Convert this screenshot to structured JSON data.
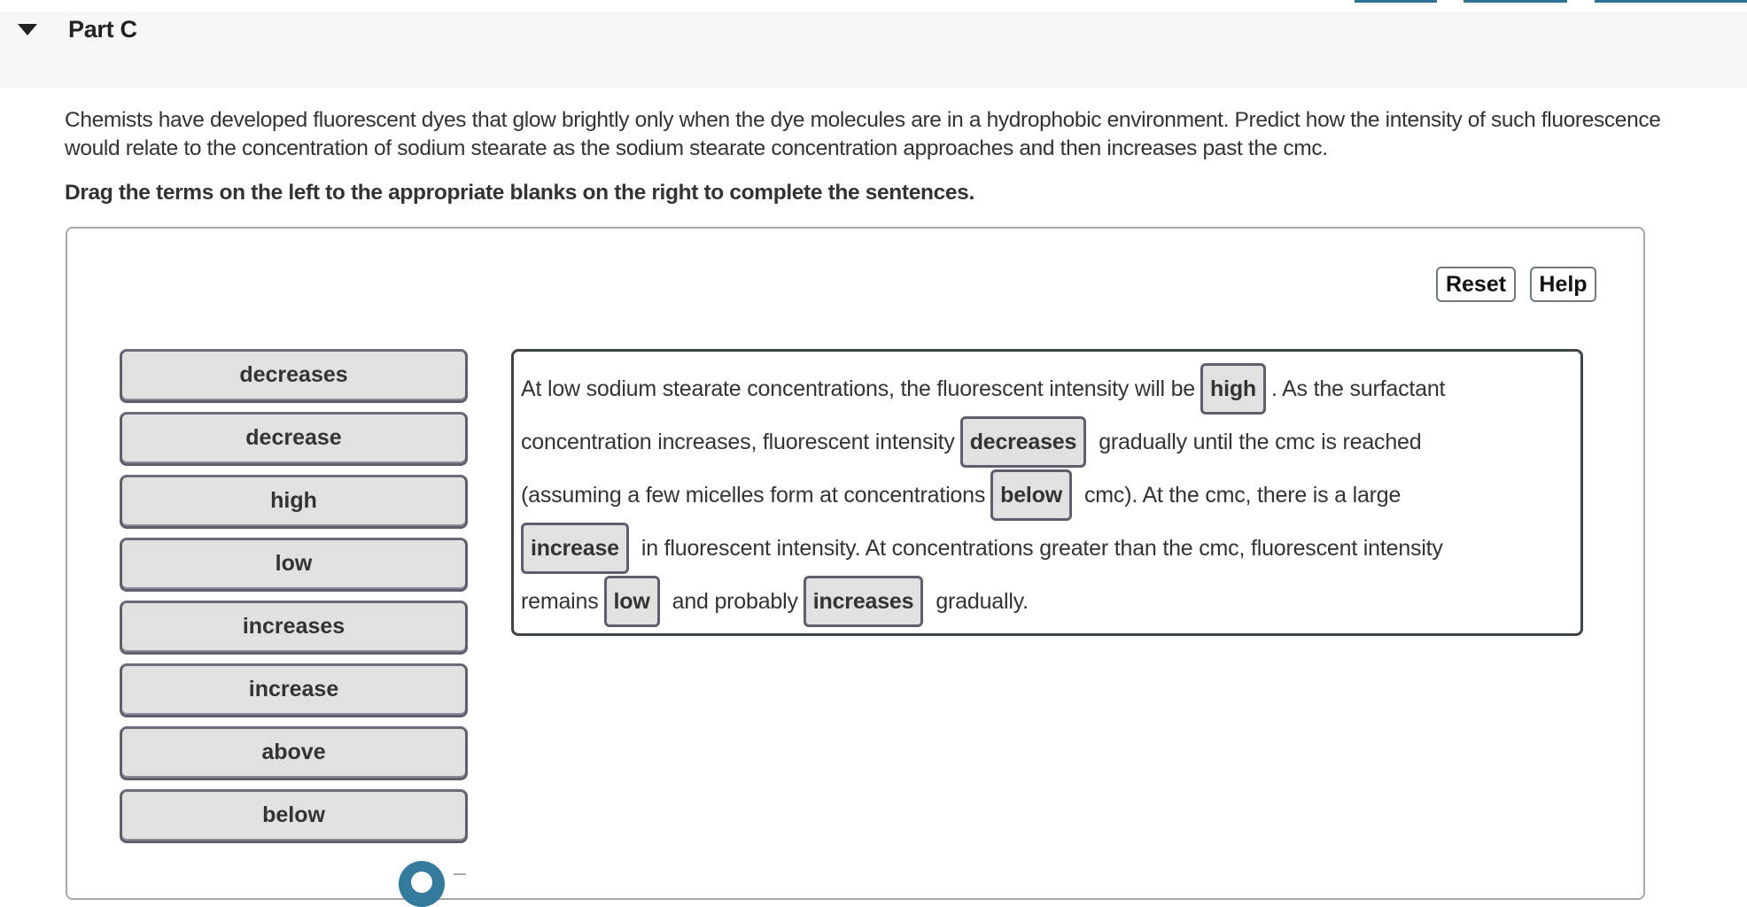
{
  "header": {
    "part_title": "Part C",
    "toggle_icon": "caret-down-icon"
  },
  "prompt": "Chemists have developed fluorescent dyes that glow brightly only when the dye molecules are in a hydrophobic environment. Predict how the intensity of such fluorescence would relate to the concentration of sodium stearate as the sodium stearate concentration approaches and then increases past the cmc.",
  "instruction": "Drag the terms on the left to the appropriate blanks on the right to complete the sentences.",
  "toolbar": {
    "reset_label": "Reset",
    "help_label": "Help"
  },
  "terms": [
    {
      "label": "decreases"
    },
    {
      "label": "decrease"
    },
    {
      "label": "high"
    },
    {
      "label": "low"
    },
    {
      "label": "increases"
    },
    {
      "label": "increase"
    },
    {
      "label": "above"
    },
    {
      "label": "below"
    }
  ],
  "sentence": {
    "line1": {
      "before": "At low sodium stearate concentrations, the fluorescent intensity will be",
      "blank": "high",
      "after": ". As the surfactant"
    },
    "line2": {
      "before": "concentration increases, fluorescent intensity",
      "blank": "decreases",
      "after": "gradually until the cmc is reached"
    },
    "line3": {
      "before": "(assuming a few micelles form at concentrations",
      "blank": "below",
      "after": "cmc). At the cmc, there is a large"
    },
    "line4": {
      "blank": "increase",
      "after": "in fluorescent intensity. At concentrations greater than the cmc, fluorescent intensity"
    },
    "line5": {
      "before": "remains",
      "blank1": "low",
      "middle": "and probably",
      "blank2": "increases",
      "after": "gradually."
    }
  },
  "colors": {
    "accent": "#2e7394",
    "term_bg": "#e1e1e1",
    "header_bg": "#f7f7f7"
  }
}
